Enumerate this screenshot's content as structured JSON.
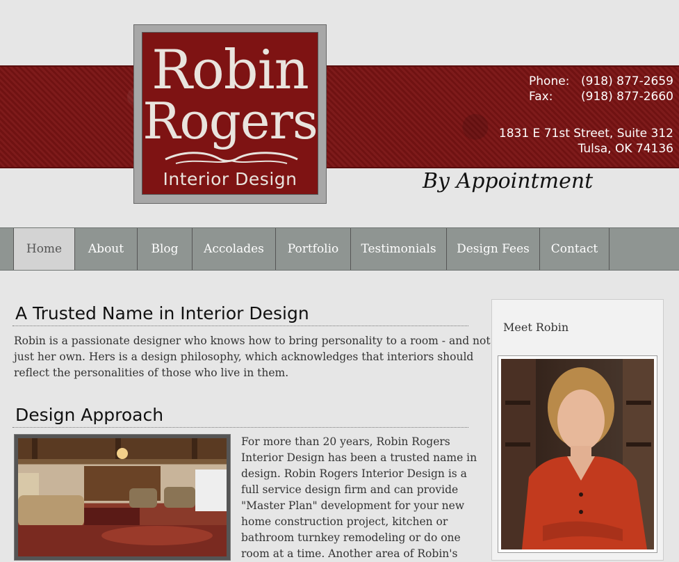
{
  "logo": {
    "line1": "Robin",
    "line2": "Rogers",
    "line3": "Interior Design"
  },
  "contact": {
    "phone_label": "Phone:",
    "phone": "(918) 877-2659",
    "fax_label": "Fax:",
    "fax": "(918) 877-2660",
    "address1": "1831 E 71st Street, Suite 312",
    "address2": "Tulsa, OK 74136"
  },
  "tagline": "By Appointment",
  "nav": {
    "items": [
      {
        "label": "Home"
      },
      {
        "label": "About"
      },
      {
        "label": "Blog"
      },
      {
        "label": "Accolades"
      },
      {
        "label": "Portfolio"
      },
      {
        "label": "Testimonials"
      },
      {
        "label": "Design Fees"
      },
      {
        "label": "Contact"
      }
    ],
    "active": "Home"
  },
  "section1": {
    "title": "A Trusted Name in Interior Design",
    "lines": [
      "Robin is a passionate designer who knows how to bring personality to a room - and not",
      "just her own. Hers is a design philosophy, which acknowledges that interiors should",
      "reflect the personalities of those who live in them."
    ]
  },
  "section2": {
    "title": "Design Approach",
    "lines": [
      "For more than 20 years, Robin Rogers",
      "Interior Design has been a trusted name in",
      "design. Robin Rogers Interior Design is a",
      "full service design firm and can provide",
      "\"Master Plan\" development for your new",
      "home construction project, kitchen or",
      "bathroom turnkey remodeling or do one",
      "room at a time. Another area of Robin's"
    ]
  },
  "sidebar": {
    "title": "Meet Robin"
  },
  "colors": {
    "banner": "#7a1414",
    "nav": "#8f9592",
    "active_tab": "#d3d3d3"
  }
}
